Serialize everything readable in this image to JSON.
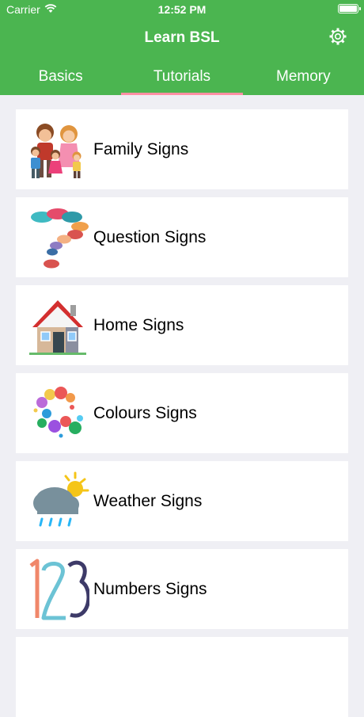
{
  "status": {
    "carrier": "Carrier",
    "time": "12:52 PM"
  },
  "nav": {
    "title": "Learn BSL",
    "settings_icon": "gear-icon"
  },
  "tabs": [
    {
      "label": "Basics",
      "active": false
    },
    {
      "label": "Tutorials",
      "active": true
    },
    {
      "label": "Memory",
      "active": false
    }
  ],
  "colors": {
    "header": "#4bb550",
    "tab_indicator": "#ff8fa3",
    "background": "#efeff4"
  },
  "items": [
    {
      "label": "Family Signs",
      "icon": "family-icon"
    },
    {
      "label": "Question Signs",
      "icon": "question-mark-icon"
    },
    {
      "label": "Home Signs",
      "icon": "house-icon"
    },
    {
      "label": "Colours Signs",
      "icon": "paint-splash-icon"
    },
    {
      "label": "Weather Signs",
      "icon": "weather-icon"
    },
    {
      "label": "Numbers Signs",
      "icon": "numbers-icon"
    }
  ]
}
